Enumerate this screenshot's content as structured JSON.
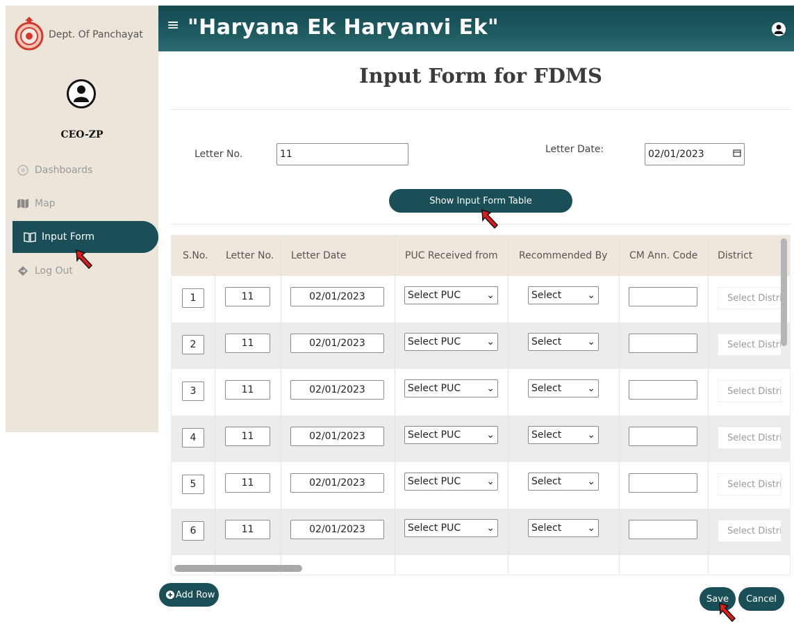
{
  "sidebar": {
    "brand": "Dept. Of Panchayat",
    "role": "CEO-ZP",
    "items": [
      {
        "label": "Dashboards",
        "icon": "dashboard-icon"
      },
      {
        "label": "Map",
        "icon": "map-icon"
      },
      {
        "label": "Input Form",
        "icon": "book-icon",
        "active": true
      },
      {
        "label": "Log Out",
        "icon": "logout-icon"
      }
    ]
  },
  "header": {
    "title": "\"Haryana Ek Haryanvi Ek\"",
    "menu_icon": "≡"
  },
  "page": {
    "title": "Input Form for FDMS"
  },
  "form": {
    "letter_no_label": "Letter No.",
    "letter_no_value": "11",
    "letter_date_label": "Letter Date:",
    "letter_date_value": "02/01/2023",
    "show_button": "Show Input Form Table"
  },
  "table": {
    "headers": [
      "S.No.",
      "Letter No.",
      "Letter Date",
      "PUC Received from",
      "Recommended By",
      "CM Ann. Code",
      "District"
    ],
    "rows": [
      {
        "sno": "1",
        "letter_no": "11",
        "letter_date": "02/01/2023",
        "puc": "Select PUC",
        "recommended": "Select",
        "cm_code": "",
        "district": "Select Distric"
      },
      {
        "sno": "2",
        "letter_no": "11",
        "letter_date": "02/01/2023",
        "puc": "Select PUC",
        "recommended": "Select",
        "cm_code": "",
        "district": "Select Distric"
      },
      {
        "sno": "3",
        "letter_no": "11",
        "letter_date": "02/01/2023",
        "puc": "Select PUC",
        "recommended": "Select",
        "cm_code": "",
        "district": "Select Distric"
      },
      {
        "sno": "4",
        "letter_no": "11",
        "letter_date": "02/01/2023",
        "puc": "Select PUC",
        "recommended": "Select",
        "cm_code": "",
        "district": "Select Distric"
      },
      {
        "sno": "5",
        "letter_no": "11",
        "letter_date": "02/01/2023",
        "puc": "Select PUC",
        "recommended": "Select",
        "cm_code": "",
        "district": "Select Distric"
      },
      {
        "sno": "6",
        "letter_no": "11",
        "letter_date": "02/01/2023",
        "puc": "Select PUC",
        "recommended": "Select",
        "cm_code": "",
        "district": "Select Distric"
      }
    ]
  },
  "actions": {
    "add_row": "Add Row",
    "save": "Save",
    "cancel": "Cancel"
  },
  "colors": {
    "primary": "#1a4f57",
    "sidebar_bg": "#ece5d9",
    "annotation_arrow": "#e01a1a"
  }
}
